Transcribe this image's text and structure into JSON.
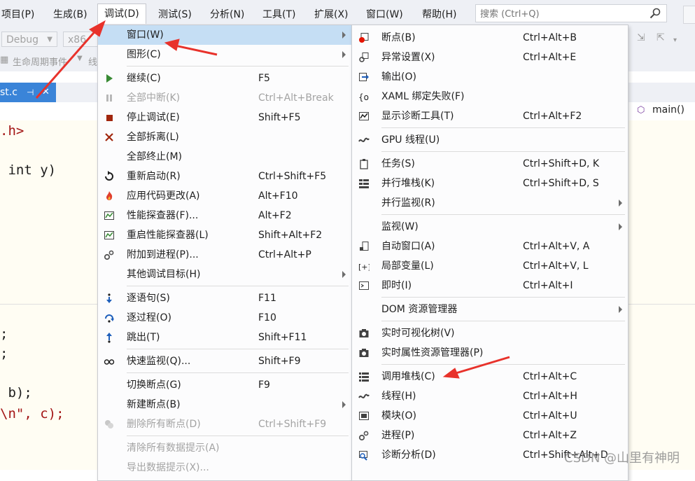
{
  "menubar": {
    "items": [
      "项目(P)",
      "生成(B)",
      "调试(D)",
      "测试(S)",
      "分析(N)",
      "工具(T)",
      "扩展(X)",
      "窗口(W)",
      "帮助(H)"
    ],
    "search_placeholder": "搜索 (Ctrl+Q)"
  },
  "toolbar": {
    "config": "Debug",
    "platform": "x86",
    "lifecycle": "生命周期事件",
    "thread_prefix": "线"
  },
  "tab": {
    "name": "st.c",
    "pin": "⊣",
    "close": "✕"
  },
  "navbar": {
    "function": "main()"
  },
  "code": {
    "line1": ".h>",
    "line2": " int y)",
    "line3": ";",
    "line4": ";",
    "line5": " b);",
    "line6": "\\n\", c);"
  },
  "debug_menu": {
    "items": [
      {
        "label": "窗口(W)",
        "shortcut": "",
        "arrow": true,
        "icon": ""
      },
      {
        "label": "图形(C)",
        "shortcut": "",
        "arrow": true,
        "icon": ""
      },
      {
        "label": "继续(C)",
        "shortcut": "F5",
        "arrow": false,
        "icon": "play-icon"
      },
      {
        "label": "全部中断(K)",
        "shortcut": "Ctrl+Alt+Break",
        "arrow": false,
        "icon": "pause-icon",
        "disabled": true
      },
      {
        "label": "停止调试(E)",
        "shortcut": "Shift+F5",
        "arrow": false,
        "icon": "stop-icon"
      },
      {
        "label": "全部拆离(L)",
        "shortcut": "",
        "arrow": false,
        "icon": "detach-x-icon"
      },
      {
        "label": "全部终止(M)",
        "shortcut": "",
        "arrow": false,
        "icon": ""
      },
      {
        "label": "重新启动(R)",
        "shortcut": "Ctrl+Shift+F5",
        "arrow": false,
        "icon": "restart-icon"
      },
      {
        "label": "应用代码更改(A)",
        "shortcut": "Alt+F10",
        "arrow": false,
        "icon": "flame-icon"
      },
      {
        "label": "性能探查器(F)...",
        "shortcut": "Alt+F2",
        "arrow": false,
        "icon": "profiler-icon"
      },
      {
        "label": "重启性能探查器(L)",
        "shortcut": "Shift+Alt+F2",
        "arrow": false,
        "icon": "profiler-icon"
      },
      {
        "label": "附加到进程(P)...",
        "shortcut": "Ctrl+Alt+P",
        "arrow": false,
        "icon": "gears-icon"
      },
      {
        "label": "其他调试目标(H)",
        "shortcut": "",
        "arrow": true,
        "icon": ""
      },
      {
        "label": "逐语句(S)",
        "shortcut": "F11",
        "arrow": false,
        "icon": "step-into-icon"
      },
      {
        "label": "逐过程(O)",
        "shortcut": "F10",
        "arrow": false,
        "icon": "step-over-icon"
      },
      {
        "label": "跳出(T)",
        "shortcut": "Shift+F11",
        "arrow": false,
        "icon": "step-out-icon"
      },
      {
        "label": "快速监视(Q)...",
        "shortcut": "Shift+F9",
        "arrow": false,
        "icon": "glasses-icon"
      },
      {
        "label": "切换断点(G)",
        "shortcut": "F9",
        "arrow": false,
        "icon": ""
      },
      {
        "label": "新建断点(B)",
        "shortcut": "",
        "arrow": true,
        "icon": ""
      },
      {
        "label": "删除所有断点(D)",
        "shortcut": "Ctrl+Shift+F9",
        "arrow": false,
        "icon": "delete-breakpoints-icon",
        "disabled": true
      },
      {
        "label": "清除所有数据提示(A)",
        "shortcut": "",
        "arrow": false,
        "icon": "",
        "disabled": true
      },
      {
        "label": "导出数据提示(X)...",
        "shortcut": "",
        "arrow": false,
        "icon": "",
        "disabled": true
      }
    ]
  },
  "window_submenu": {
    "items": [
      {
        "label": "断点(B)",
        "shortcut": "Ctrl+Alt+B",
        "icon": "breakpoint-window-icon"
      },
      {
        "label": "异常设置(X)",
        "shortcut": "Ctrl+Alt+E",
        "icon": "exception-settings-icon"
      },
      {
        "label": "输出(O)",
        "shortcut": "",
        "icon": "output-icon"
      },
      {
        "label": "XAML 绑定失败(F)",
        "shortcut": "",
        "icon": "xaml-binding-icon"
      },
      {
        "label": "显示诊断工具(T)",
        "shortcut": "Ctrl+Alt+F2",
        "icon": "diagnostic-tools-icon"
      },
      {
        "label": "GPU 线程(U)",
        "shortcut": "",
        "icon": "gpu-threads-icon"
      },
      {
        "label": "任务(S)",
        "shortcut": "Ctrl+Shift+D, K",
        "icon": "tasks-icon"
      },
      {
        "label": "并行堆栈(K)",
        "shortcut": "Ctrl+Shift+D, S",
        "icon": "parallel-stacks-icon"
      },
      {
        "label": "并行监视(R)",
        "shortcut": "",
        "icon": "",
        "arrow": true
      },
      {
        "label": "监视(W)",
        "shortcut": "",
        "icon": "",
        "arrow": true
      },
      {
        "label": "自动窗口(A)",
        "shortcut": "Ctrl+Alt+V, A",
        "icon": "autos-icon"
      },
      {
        "label": "局部变量(L)",
        "shortcut": "Ctrl+Alt+V, L",
        "icon": "locals-icon"
      },
      {
        "label": "即时(I)",
        "shortcut": "Ctrl+Alt+I",
        "icon": "immediate-icon"
      },
      {
        "label": "DOM 资源管理器",
        "shortcut": "",
        "icon": "",
        "arrow": true
      },
      {
        "label": "实时可视化树(V)",
        "shortcut": "",
        "icon": "camera-icon"
      },
      {
        "label": "实时属性资源管理器(P)",
        "shortcut": "",
        "icon": "camera-icon"
      },
      {
        "label": "调用堆栈(C)",
        "shortcut": "Ctrl+Alt+C",
        "icon": "call-stack-icon"
      },
      {
        "label": "线程(H)",
        "shortcut": "Ctrl+Alt+H",
        "icon": "threads-icon"
      },
      {
        "label": "模块(O)",
        "shortcut": "Ctrl+Alt+U",
        "icon": "modules-icon"
      },
      {
        "label": "进程(P)",
        "shortcut": "Ctrl+Alt+Z",
        "icon": "processes-icon"
      },
      {
        "label": "诊断分析(D)",
        "shortcut": "Ctrl+Shift+Alt+D",
        "icon": "diagnostic-analysis-icon"
      }
    ]
  },
  "colors": {
    "accent": "#3a84d8",
    "highlight": "#c5def4",
    "annotation_red": "#e8322b"
  },
  "watermark": "CSDN @山里有神明"
}
